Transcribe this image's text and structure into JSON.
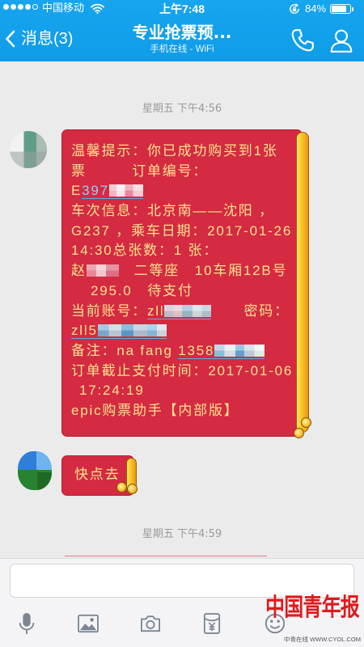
{
  "status_bar": {
    "signal": {
      "filled": 4,
      "total": 5
    },
    "carrier": "中国移动",
    "time": "上午7:48",
    "battery_percent": "84%",
    "battery_level": 0.84
  },
  "header": {
    "back_label": "消息(3)",
    "title": "专业抢票预...",
    "subtitle": "手机在线 - WiFi"
  },
  "chat": {
    "timestamps": [
      "星期五 下午4:56",
      "星期五 下午4:59"
    ],
    "ticket_message": {
      "lines": [
        [
          "温馨提示：你已成功购买到1张"
        ],
        [
          "票　　　订单编号："
        ],
        [
          "E",
          "397"
        ],
        [
          "车次信息：北京南——沈阳 ，"
        ],
        [
          "G237 ，乘车日期：2017-01-26"
        ],
        [
          "14:30总张数：1 张："
        ],
        [
          "赵",
          "　二等座　10车厢12B号"
        ],
        [
          "295.0　待支付"
        ],
        [
          "当前账号：",
          "zll",
          "密码："
        ],
        [
          "zll5"
        ],
        [
          "备注：na fang ",
          "1358"
        ],
        [
          "订单截止支付时间：2017-01-06"
        ],
        [
          "17:24:19"
        ],
        [
          "epic购票助手【内部版】"
        ]
      ]
    },
    "short_message": {
      "text": "快点去"
    }
  },
  "input": {
    "value": ""
  },
  "toolbar": {
    "icons": [
      "microphone-icon",
      "image-icon",
      "camera-icon",
      "red-packet-icon",
      "emoji-icon"
    ]
  },
  "watermark": {
    "logo": "中国青年报",
    "site": "中青在线 WWW.CYOL.COM"
  },
  "colors": {
    "header_blue": "#17a5ef",
    "chat_bg": "#ebebeb",
    "bubble_red": "#d42a42",
    "bubble_text": "#fce38c",
    "link_blue": "#5aaeea",
    "icon_gray": "#7c8794",
    "watermark_red": "#e0191c"
  }
}
